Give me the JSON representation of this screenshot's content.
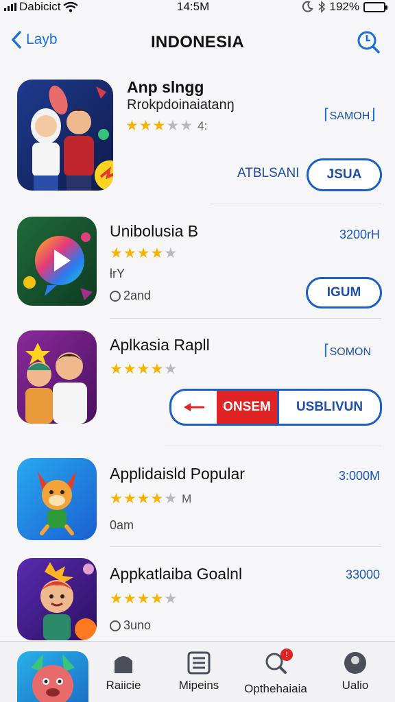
{
  "status_bar": {
    "carrier": "Dabicict",
    "time": "14:5M",
    "battery": "192%",
    "battery_level": 0.92
  },
  "nav": {
    "back_label": "Layb",
    "title": "INDONESIA"
  },
  "apps": [
    {
      "name": "Anp slngg",
      "subtitle": "Rrokpdoinaiatanŋ",
      "rating": 3,
      "rating_extra": "4:",
      "tag": "SAMOH",
      "secondary_label": "ATBLSANI",
      "action_label": "JSUA"
    },
    {
      "name": "Unibolusia B",
      "rating": 4,
      "price": "3200rH",
      "meta1": "ƚrY",
      "meta2": "2and",
      "action_label": "IGUM"
    },
    {
      "name": "Aplkasia Rapll",
      "rating": 4,
      "tag": "SOMON",
      "action_left": "ONSEM",
      "action_right": "USBLIVUN"
    },
    {
      "name": "Applidaisld Popular",
      "rating": 4,
      "rating_extra": "M",
      "price": "3:000M",
      "meta1": "0am"
    },
    {
      "name": "Appkatlaiba Goalnl",
      "rating": 4,
      "price": "33000",
      "meta1": "3uno"
    }
  ],
  "tabs": [
    {
      "label": "Raiicie"
    },
    {
      "label": "Mipeins"
    },
    {
      "label": "Opthehaiaia"
    },
    {
      "label": "Ualio"
    }
  ],
  "colors": {
    "accent": "#1a6fd8",
    "star": "#f4b400",
    "red": "#e02424"
  }
}
